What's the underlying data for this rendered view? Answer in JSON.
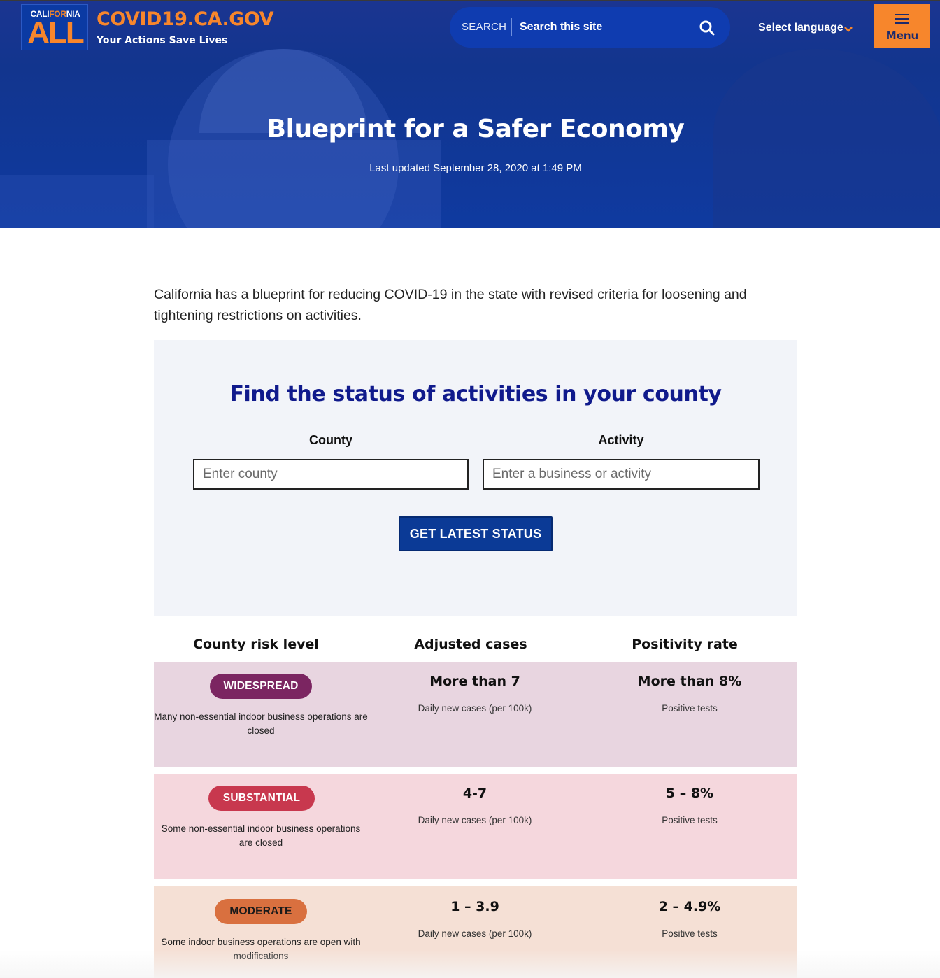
{
  "header": {
    "logo_top": "CALIFORNIA",
    "logo_top_a": "CALI",
    "logo_top_b": "FOR",
    "logo_top_c": "NIA",
    "logo_main": "ALL",
    "site_title": "COVID19.CA.GOV",
    "tagline": "Your Actions Save Lives",
    "search_label": "SEARCH",
    "search_placeholder": "Search this site",
    "language_label": "Select language",
    "menu_label": "Menu"
  },
  "hero": {
    "title": "Blueprint for a Safer Economy",
    "updated": "Last updated September 28, 2020 at 1:49 PM"
  },
  "intro": "California has a blueprint for reducing COVID-19 in the state with revised criteria for loosening and tightening restrictions on activities.",
  "finder": {
    "title": "Find the status of activities in your county",
    "county_label": "County",
    "county_placeholder": "Enter county",
    "activity_label": "Activity",
    "activity_placeholder": "Enter a business or activity",
    "button_label": "GET LATEST STATUS"
  },
  "table": {
    "headers": [
      "County risk level",
      "Adjusted cases",
      "Positivity rate"
    ],
    "tiers": [
      {
        "badge": "WIDESPREAD",
        "description": "Many non-essential indoor business operations are closed",
        "cases": "More than 7",
        "cases_sub": "Daily new cases (per 100k)",
        "positivity": "More than 8%",
        "positivity_sub": "Positive tests"
      },
      {
        "badge": "SUBSTANTIAL",
        "description": "Some non-essential indoor business operations are closed",
        "cases": "4-7",
        "cases_sub": "Daily new cases (per 100k)",
        "positivity": "5 – 8%",
        "positivity_sub": "Positive tests"
      },
      {
        "badge": "MODERATE",
        "description": "Some indoor business operations are open with modifications",
        "cases": "1 – 3.9",
        "cases_sub": "Daily new cases (per 100k)",
        "positivity": "2 – 4.9%",
        "positivity_sub": "Positive tests"
      }
    ]
  },
  "colors": {
    "brand_blue": "#0b3a96",
    "brand_orange": "#f7862c",
    "finder_title": "#101a8c",
    "widespread_badge": "#7b2561",
    "widespread_bg": "#e8d5e0",
    "substantial_badge": "#c8384e",
    "substantial_bg": "#f5d7dd",
    "moderate_badge": "#d9703f",
    "moderate_bg": "#f5e0d5"
  }
}
